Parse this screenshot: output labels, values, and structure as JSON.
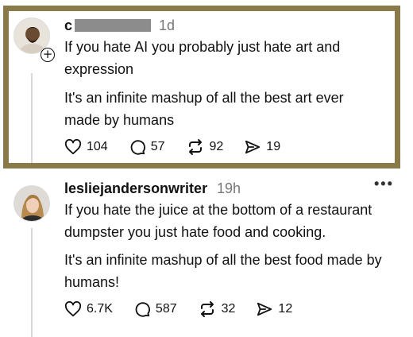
{
  "posts": [
    {
      "username": "c",
      "time": "1d",
      "paragraphs": [
        "If you hate AI you probably just hate art and expression",
        "It's an infinite mashup of all the best art ever made by humans"
      ],
      "likes": "104",
      "replies": "57",
      "reposts": "92",
      "shares": "19"
    },
    {
      "username": "lesliejandersonwriter",
      "time": "19h",
      "paragraphs": [
        "If you hate the juice at the bottom of a restaurant dumpster you just hate food and cooking.",
        "It's an infinite mashup of all the best food made by humans!"
      ],
      "likes": "6.7K",
      "replies": "587",
      "reposts": "32",
      "shares": "12"
    }
  ],
  "icons": {
    "like": "heart-icon",
    "reply": "comment-icon",
    "repost": "repost-icon",
    "share": "send-icon",
    "more": "more-options-icon",
    "follow": "plus-icon"
  },
  "colors": {
    "highlight_frame": "#8a7a4a",
    "redaction": "#8c8c8c"
  }
}
